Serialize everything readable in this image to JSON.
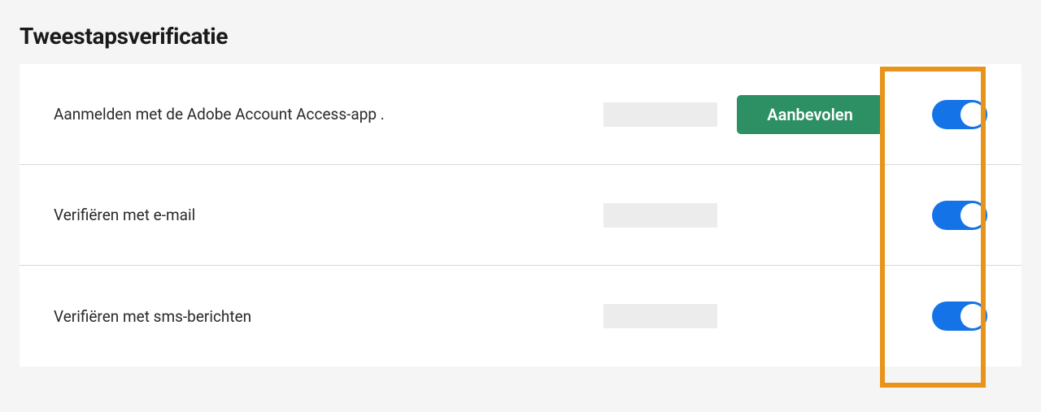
{
  "section": {
    "title": "Tweestapsverificatie"
  },
  "rows": [
    {
      "label": "Aanmelden met de Adobe Account Access-app .",
      "badge": "Aanbevolen",
      "toggle_on": true,
      "has_badge": true
    },
    {
      "label": "Verifiëren met e-mail",
      "badge": "",
      "toggle_on": true,
      "has_badge": false
    },
    {
      "label": "Verifiëren met sms-berichten",
      "badge": "",
      "toggle_on": true,
      "has_badge": false
    }
  ],
  "colors": {
    "toggle_on": "#1473e6",
    "badge_bg": "#2d8f64",
    "highlight_border": "#e8941a"
  }
}
